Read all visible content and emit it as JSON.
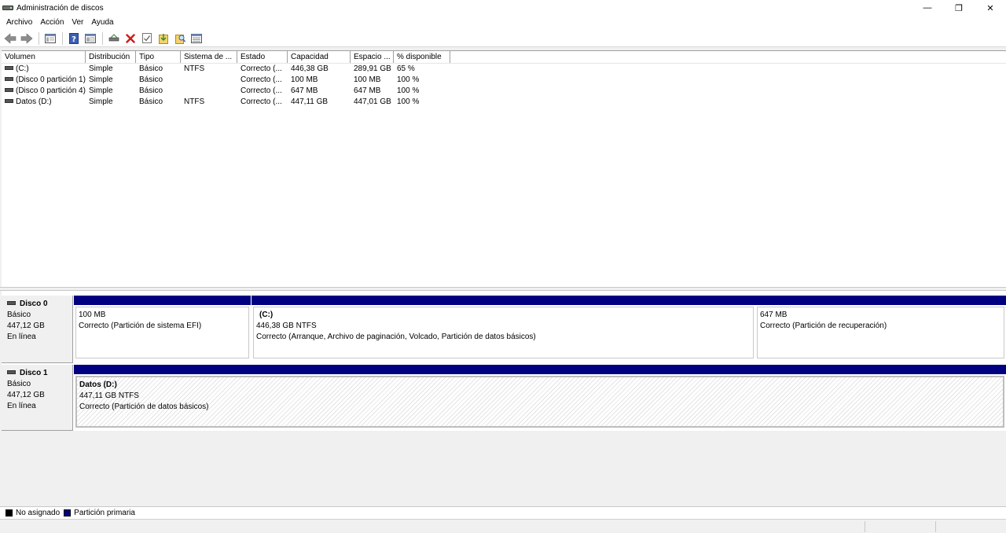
{
  "window": {
    "title": "Administración de discos",
    "minimize_glyph": "—",
    "restore_glyph": "❐",
    "close_glyph": "✕"
  },
  "menu": [
    "Archivo",
    "Acción",
    "Ver",
    "Ayuda"
  ],
  "toolbar_icons": [
    "back-icon",
    "forward-icon",
    "console-tree-icon",
    "help-icon",
    "properties-icon",
    "connect-disk-icon",
    "delete-icon",
    "check-icon",
    "import-icon",
    "find-icon",
    "list-view-icon"
  ],
  "colors": {
    "primary_partition": "#000080",
    "unallocated": "#000000"
  },
  "volume_list": {
    "columns": [
      "Volumen",
      "Distribución",
      "Tipo",
      "Sistema de ...",
      "Estado",
      "Capacidad",
      "Espacio ...",
      "% disponible"
    ],
    "rows": [
      [
        "(C:)",
        "Simple",
        "Básico",
        "NTFS",
        "Correcto (...",
        "446,38 GB",
        "289,91 GB",
        "65 %"
      ],
      [
        "(Disco 0 partición 1)",
        "Simple",
        "Básico",
        "",
        "Correcto (...",
        "100 MB",
        "100 MB",
        "100 %"
      ],
      [
        "(Disco 0 partición 4)",
        "Simple",
        "Básico",
        "",
        "Correcto (...",
        "647 MB",
        "647 MB",
        "100 %"
      ],
      [
        "Datos (D:)",
        "Simple",
        "Básico",
        "NTFS",
        "Correcto (...",
        "447,11 GB",
        "447,01 GB",
        "100 %"
      ]
    ]
  },
  "disks": [
    {
      "name": "Disco 0",
      "type": "Básico",
      "size": "447,12 GB",
      "status": "En línea",
      "partitions": [
        {
          "label": "",
          "size": "100 MB",
          "status": "Correcto (Partición de sistema EFI)"
        },
        {
          "label": "(C:)",
          "size": "446,38 GB NTFS",
          "status": "Correcto (Arranque, Archivo de paginación, Volcado, Partición de datos básicos)"
        },
        {
          "label": "",
          "size": "647 MB",
          "status": "Correcto (Partición de recuperación)"
        }
      ]
    },
    {
      "name": "Disco 1",
      "type": "Básico",
      "size": "447,12 GB",
      "status": "En línea",
      "partitions": [
        {
          "label": "Datos  (D:)",
          "size": "447,11 GB NTFS",
          "status": "Correcto (Partición de datos básicos)"
        }
      ]
    }
  ],
  "legend": [
    {
      "label": "No asignado",
      "color": "#000000"
    },
    {
      "label": "Partición primaria",
      "color": "#000080"
    }
  ]
}
